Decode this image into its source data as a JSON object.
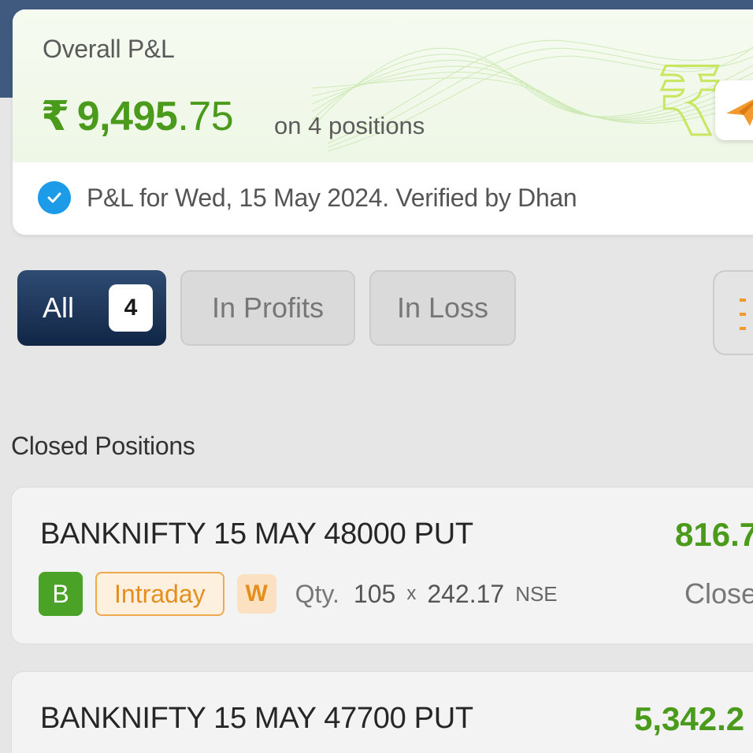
{
  "summary": {
    "title": "Overall P&L",
    "currency_symbol": "₹",
    "amount_whole": "9,495",
    "amount_decimal": ".75",
    "positions_text": "on 4 positions",
    "verified_text": "P&L for Wed, 15 May 2024. Verified by Dhan"
  },
  "filters": {
    "all_label": "All",
    "all_count": "4",
    "profits_label": "In Profits",
    "loss_label": "In Loss"
  },
  "section_title": "Closed Positions",
  "positions": [
    {
      "name": "BANKNIFTY 15 MAY 48000 PUT",
      "pnl": "816.7",
      "side": "B",
      "product": "Intraday",
      "expiry_tag": "W",
      "qty_label": "Qty.",
      "qty": "105",
      "x": "x",
      "price": "242.17",
      "exchange": "NSE",
      "status": "Close"
    },
    {
      "name": "BANKNIFTY 15 MAY 47700 PUT",
      "pnl": "5,342.2"
    }
  ],
  "colors": {
    "profit_green": "#4a9a1c",
    "header_navy": "#3f5a7e",
    "accent_orange": "#e48f1d",
    "verified_blue": "#1b9be8"
  }
}
